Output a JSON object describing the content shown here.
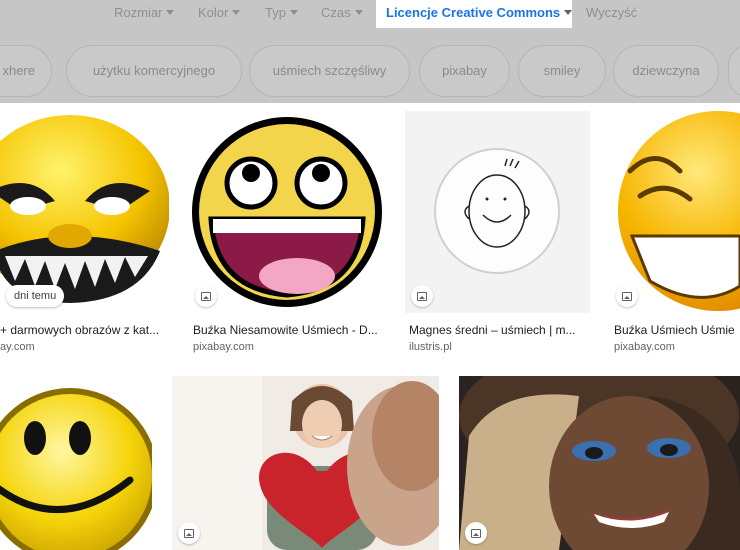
{
  "toolbar": {
    "tools": [
      {
        "label": "Rozmiar"
      },
      {
        "label": "Kolor"
      },
      {
        "label": "Typ"
      },
      {
        "label": "Czas"
      },
      {
        "label": "Licencje Creative Commons"
      },
      {
        "label": "Wyczyść"
      }
    ]
  },
  "chips": [
    "xhere",
    "użytku komercyjnego",
    "uśmiech szczęśliwy",
    "pixabay",
    "smiley",
    "dziewczyna"
  ],
  "results": [
    {
      "badge": "dni temu",
      "title": "+ darmowych obrazów z kat...",
      "source": "ay.com"
    },
    {
      "badge": "",
      "title": "Buźka Niesamowite Uśmiech - D...",
      "source": "pixabay.com"
    },
    {
      "badge": "",
      "title": "Magnes średni – uśmiech | m...",
      "source": "ilustris.pl"
    },
    {
      "badge": "",
      "title": "Buźka Uśmiech Uśmie",
      "source": "pixabay.com"
    },
    {
      "badge": ""
    },
    {
      "badge": ""
    },
    {
      "badge": ""
    }
  ],
  "colors": {
    "accent": "#1a73e8",
    "overlay": "#c6c6c6",
    "title": "#202124",
    "source": "#5f6368"
  }
}
